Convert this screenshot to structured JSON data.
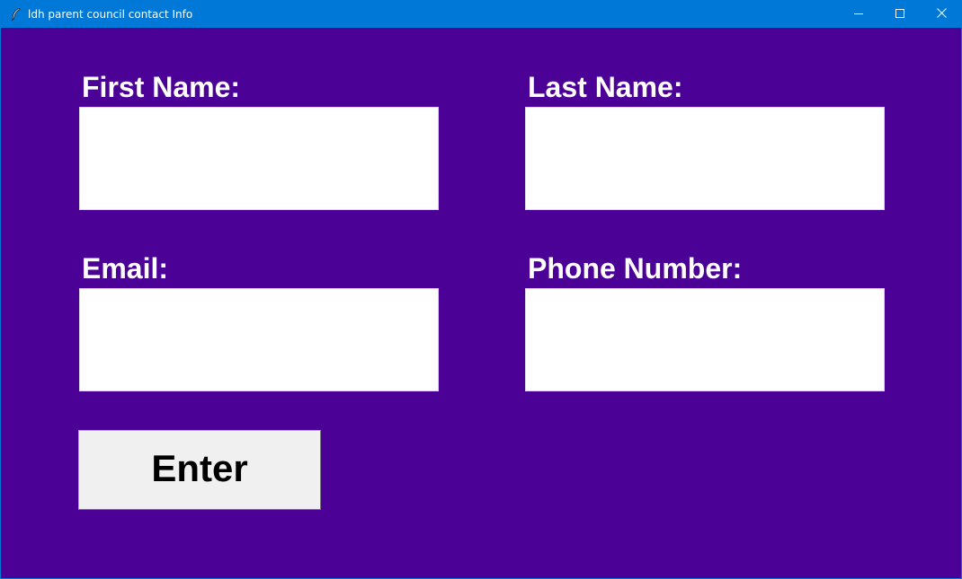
{
  "window": {
    "title": "ldh parent council contact Info",
    "accent_color": "#0078d7",
    "background_color": "#4b0096",
    "controls": {
      "minimize_icon": "minimize-icon",
      "maximize_icon": "maximize-icon",
      "close_icon": "close-icon"
    }
  },
  "form": {
    "first_name": {
      "label": "First Name:",
      "value": ""
    },
    "last_name": {
      "label": "Last Name:",
      "value": ""
    },
    "email": {
      "label": "Email:",
      "value": ""
    },
    "phone_number": {
      "label": "Phone Number:",
      "value": ""
    },
    "enter_button": {
      "label": "Enter"
    }
  }
}
